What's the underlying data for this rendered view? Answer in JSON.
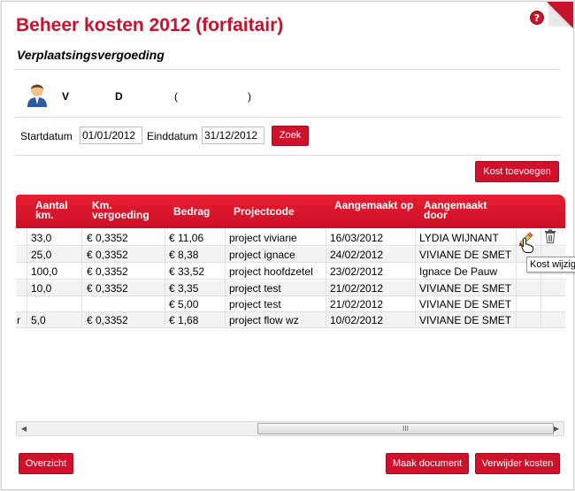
{
  "page": {
    "title": "Beheer kosten 2012 (forfaitair)",
    "subtitle": "Verplaatsingsvergoeding",
    "help_glyph": "?"
  },
  "person": {
    "first": "V",
    "last": "D",
    "paren_open": "(",
    "paren_close": ")"
  },
  "search": {
    "start_label": "Startdatum",
    "start_value": "01/01/2012",
    "end_label": "Einddatum",
    "end_value": "31/12/2012",
    "button": "Zoek"
  },
  "add_button": "Kost toevoegen",
  "table": {
    "headers": {
      "aantal": "Aantal km.",
      "km": "Km. vergoeding",
      "bedrag": "Bedrag",
      "project": "Projectcode",
      "aangemaakt_op": "Aangemaakt op",
      "aangemaakt_door": "Aangemaakt door"
    },
    "rows": [
      {
        "pre": "",
        "aantal": "33,0",
        "km": "€ 0,3352",
        "bedrag": "€ 11,06",
        "project": "project viviane",
        "op": "16/03/2012",
        "door": "LYDIA WIJNANT"
      },
      {
        "pre": "",
        "aantal": "25,0",
        "km": "€ 0,3352",
        "bedrag": "€ 8,38",
        "project": "project ignace",
        "op": "24/02/2012",
        "door": "VIVIANE DE SMET"
      },
      {
        "pre": "",
        "aantal": "100,0",
        "km": "€ 0,3352",
        "bedrag": "€ 33,52",
        "project": "project hoofdzetel",
        "op": "23/02/2012",
        "door": "Ignace De Pauw"
      },
      {
        "pre": "",
        "aantal": "10,0",
        "km": "€ 0,3352",
        "bedrag": "€ 3,35",
        "project": "project test",
        "op": "21/02/2012",
        "door": "VIVIANE DE SMET"
      },
      {
        "pre": "",
        "aantal": "",
        "km": "",
        "bedrag": "€ 5,00",
        "project": "project test",
        "op": "21/02/2012",
        "door": "VIVIANE DE SMET"
      },
      {
        "pre": "r",
        "aantal": "5,0",
        "km": "€ 0,3352",
        "bedrag": "€ 1,68",
        "project": "project flow wz",
        "op": "10/02/2012",
        "door": "VIVIANE DE SMET"
      }
    ]
  },
  "tooltip": "Kost wijzig",
  "scrollbar_grip": "III",
  "footer": {
    "overview": "Overzicht",
    "make_document": "Maak document",
    "delete_costs": "Verwijder kosten"
  },
  "icons": {
    "help": "help-icon",
    "user": "user-avatar-icon",
    "edit": "pencil-icon",
    "delete": "trash-icon"
  },
  "colors": {
    "accent": "#c6132b"
  }
}
